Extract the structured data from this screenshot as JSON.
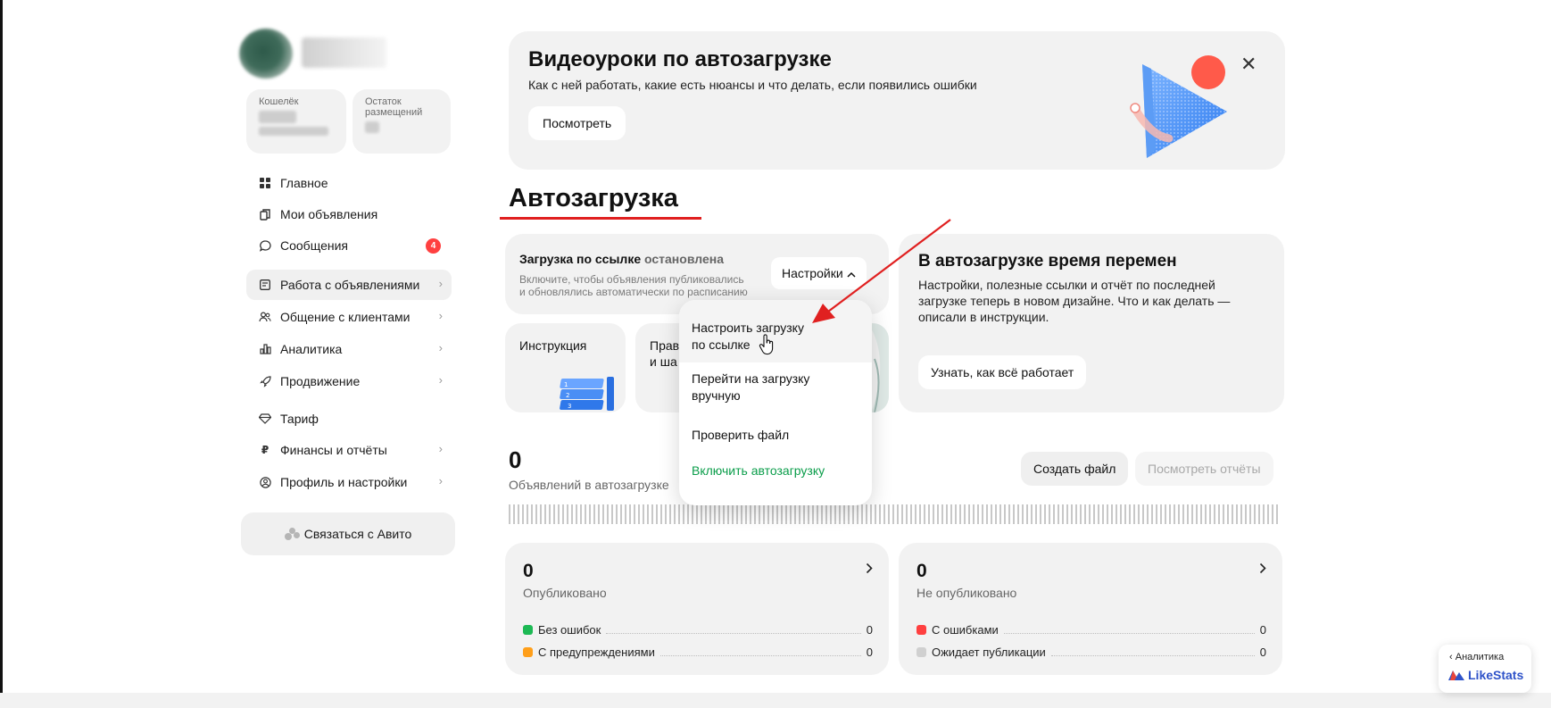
{
  "sidebar": {
    "wallet_label": "Кошелёк",
    "placements_label": "Остаток размещений",
    "nav": [
      {
        "label": "Главное",
        "icon": "grid-icon"
      },
      {
        "label": "Мои объявления",
        "icon": "copy-icon"
      },
      {
        "label": "Сообщения",
        "icon": "chat-icon",
        "badge": "4"
      },
      {
        "label": "Работа с объявлениями",
        "icon": "list-icon"
      },
      {
        "label": "Общение с клиентами",
        "icon": "users-icon"
      },
      {
        "label": "Аналитика",
        "icon": "bar-chart-icon"
      },
      {
        "label": "Продвижение",
        "icon": "rocket-icon"
      },
      {
        "label": "Тариф",
        "icon": "diamond-icon"
      },
      {
        "label": "Финансы и отчёты",
        "icon": "ruble-icon"
      },
      {
        "label": "Профиль и настройки",
        "icon": "user-circle-icon"
      }
    ],
    "contact_label": "Связаться с Авито"
  },
  "banner": {
    "title": "Видеоуроки по автозагрузке",
    "subtitle": "Как с ней работать, какие есть нюансы и что делать, если появились ошибки",
    "button": "Посмотреть"
  },
  "page": {
    "title": "Автозагрузка"
  },
  "upload": {
    "title_prefix": "Загрузка по ссылке",
    "status": "остановлена",
    "desc_line1": "Включите, чтобы объявления публиковались",
    "desc_line2": "и обновлялись автоматически по расписанию",
    "settings_label": "Настройки"
  },
  "tiles": {
    "instruction": "Инструкция",
    "second_line1": "Прав",
    "second_line2": "и ша"
  },
  "dropdown": {
    "items": [
      {
        "line1": "Настроить загрузку",
        "line2": "по ссылке"
      },
      {
        "line1": "Перейти на загрузку",
        "line2": "вручную"
      },
      {
        "line1": "Проверить файл"
      },
      {
        "line1": "Включить автозагрузку"
      }
    ]
  },
  "change": {
    "title": "В автозагрузке время перемен",
    "line1": "Настройки, полезные ссылки и отчёт по последней",
    "line2": "загрузке теперь в новом дизайне. Что и как делать —",
    "line3": "описали в инструкции.",
    "button": "Узнать, как всё работает"
  },
  "counter": {
    "value": "0",
    "label": "Объявлений в автозагрузке",
    "create_file": "Создать файл",
    "view_reports": "Посмотреть отчёты"
  },
  "published": {
    "value": "0",
    "label": "Опубликовано",
    "rows": [
      {
        "label": "Без ошибок",
        "value": "0",
        "color": "#1db954"
      },
      {
        "label": "С предупреждениями",
        "value": "0",
        "color": "#ff9f1a"
      }
    ]
  },
  "unpublished": {
    "value": "0",
    "label": "Не опубликовано",
    "rows": [
      {
        "label": "С ошибками",
        "value": "0",
        "color": "#ff4040"
      },
      {
        "label": "Ожидает публикации",
        "value": "0",
        "color": "#d0d0d0"
      }
    ]
  },
  "likestats": {
    "back_label": "Аналитика",
    "brand": "LikeStats"
  },
  "colors": {
    "accent_green": "#0a9d4a",
    "badge_red": "#ff4040",
    "annotation_red": "#e02020"
  }
}
